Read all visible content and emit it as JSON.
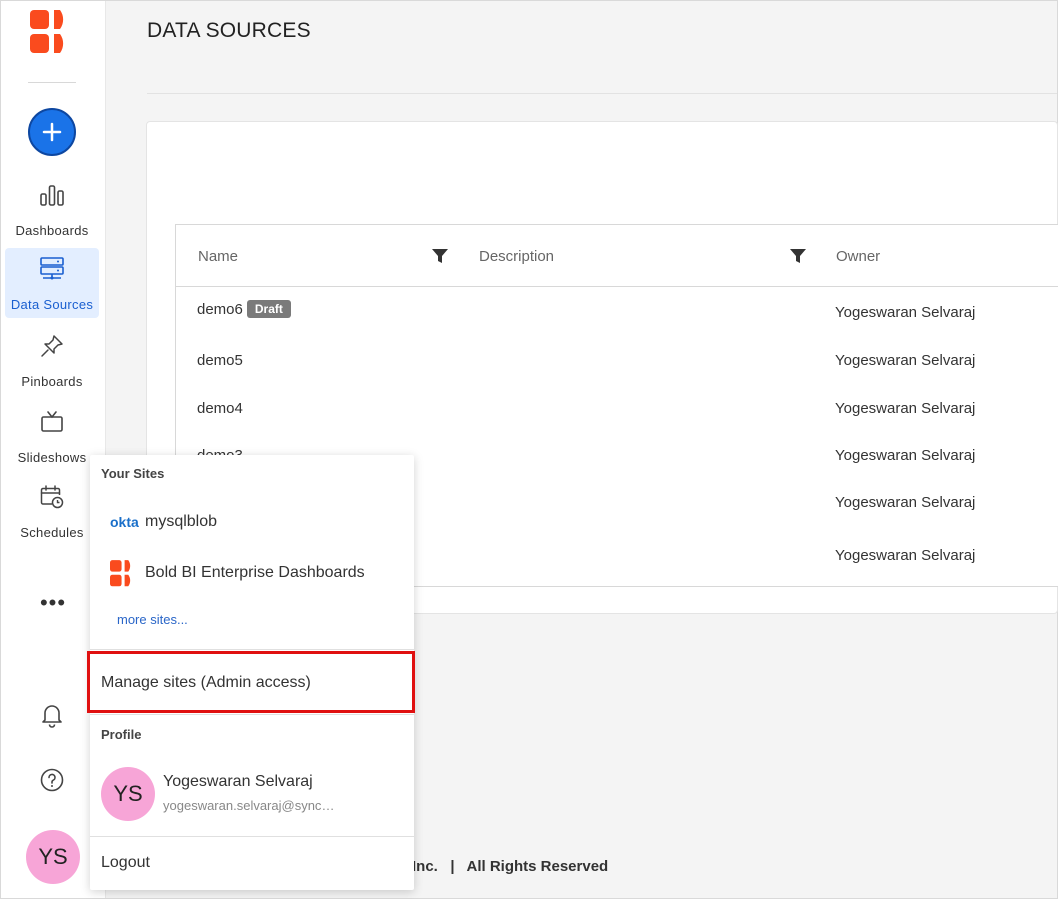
{
  "page": {
    "title": "DATA SOURCES"
  },
  "sidebar": {
    "items": [
      {
        "label": "Dashboards",
        "icon": "bar-chart-icon"
      },
      {
        "label": "Data Sources",
        "icon": "server-icon",
        "active": true
      },
      {
        "label": "Pinboards",
        "icon": "pin-icon"
      },
      {
        "label": "Slideshows",
        "icon": "tv-icon"
      },
      {
        "label": "Schedules",
        "icon": "calendar-clock-icon"
      }
    ],
    "more": "•••",
    "avatar_initials": "YS"
  },
  "table": {
    "columns": {
      "name": "Name",
      "description": "Description",
      "owner": "Owner"
    },
    "rows": [
      {
        "name": "demo6",
        "badge": "Draft",
        "owner": "Yogeswaran Selvaraj"
      },
      {
        "name": "demo5",
        "owner": "Yogeswaran Selvaraj"
      },
      {
        "name": "demo4",
        "owner": "Yogeswaran Selvaraj"
      },
      {
        "name": "demo3",
        "owner": "Yogeswaran Selvaraj"
      },
      {
        "name": "",
        "owner": "Yogeswaran Selvaraj"
      },
      {
        "name": "",
        "owner": "Yogeswaran Selvaraj"
      }
    ]
  },
  "footer": {
    "text": "Inc.   |   All Rights Reserved"
  },
  "popup": {
    "your_sites_heading": "Your Sites",
    "sites": [
      {
        "label": "mysqlblob",
        "icon": "okta-logo",
        "icon_text": "okta"
      },
      {
        "label": "Bold BI Enterprise Dashboards",
        "icon": "boldbi-logo"
      }
    ],
    "more_sites": "more sites...",
    "manage_sites": "Manage sites (Admin access)",
    "profile_heading": "Profile",
    "profile": {
      "initials": "YS",
      "name": "Yogeswaran Selvaraj",
      "email": "yogeswaran.selvaraj@syncfusion.com"
    },
    "logout": "Logout"
  },
  "colors": {
    "brand": "#fa4b1e",
    "accent": "#1a73e8",
    "avatar": "#f7a5d7",
    "highlight": "#e01010"
  }
}
